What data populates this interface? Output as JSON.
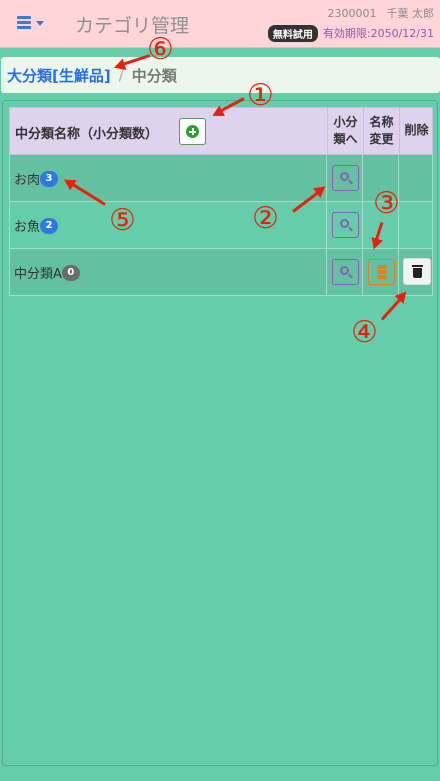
{
  "header": {
    "app_title": "カテゴリ管理",
    "user_id": "2300001",
    "user_name": "千葉 太郎",
    "plan_badge": "無料試用",
    "expiry": "有効期限:2050/12/31"
  },
  "breadcrumb": {
    "parent": "大分類[生鮮品]",
    "separator": "/",
    "current": "中分類"
  },
  "table": {
    "headers": {
      "name": "中分類名称（小分類数）",
      "to_sub_line1": "小分",
      "to_sub_line2": "類へ",
      "rename_line1": "名称",
      "rename_line2": "変更",
      "delete": "削除"
    },
    "rows": [
      {
        "name": "お肉",
        "count": "3"
      },
      {
        "name": "お魚",
        "count": "2"
      },
      {
        "name": "中分類A",
        "count": "0"
      }
    ]
  },
  "annotations": {
    "a1": "①",
    "a2": "②",
    "a3": "③",
    "a4": "④",
    "a5": "⑤",
    "a6": "⑥"
  },
  "colors": {
    "background": "#66cdaa",
    "header": "#ffd5d8",
    "table_header": "#ded2ee",
    "badge_blue": "#2c7be5",
    "badge_grey": "#6c6c6c",
    "annotation": "#e8200f"
  }
}
